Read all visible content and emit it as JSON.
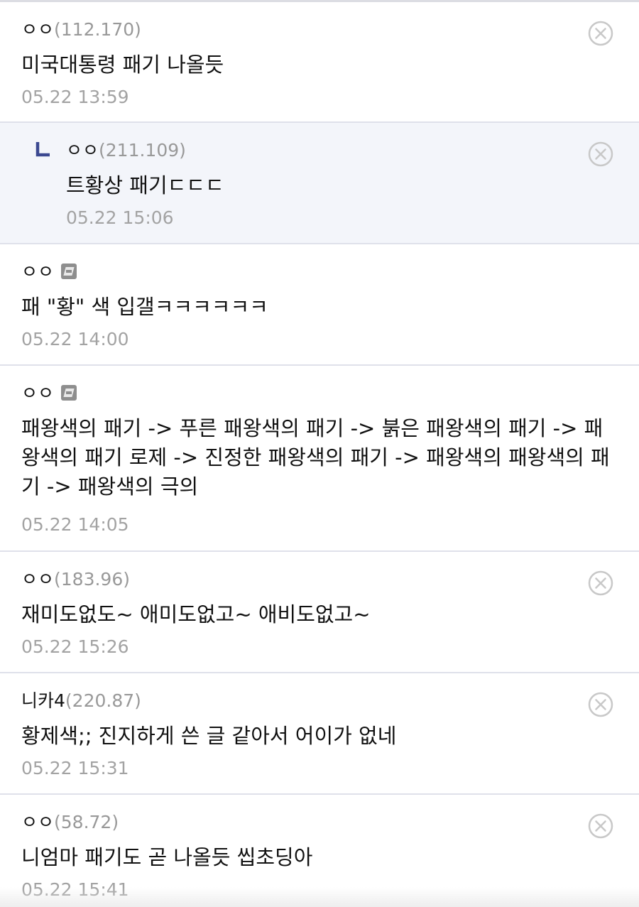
{
  "comments": [
    {
      "name": "ㅇㅇ",
      "ip": "(112.170)",
      "text": "미국대통령 패기 나올듯",
      "date": "05.22 13:59"
    },
    {
      "name": "ㅇㅇ",
      "ip": "(211.109)",
      "text": "트황상 패기ㄷㄷㄷ",
      "date": "05.22 15:06"
    },
    {
      "name": "ㅇㅇ",
      "text": "패 \"황\" 색 입갤ㅋㅋㅋㅋㅋㅋ",
      "date": "05.22 14:00"
    },
    {
      "name": "ㅇㅇ",
      "text": "패왕색의 패기 -> 푸른 패왕색의 패기 -> 붉은 패왕색의 패기 -> 패왕색의 패기 로제 -> 진정한 패왕색의 패기 -> 패왕색의 패왕색의 패기 -> 패왕색의 극의",
      "date": "05.22 14:05"
    },
    {
      "name": "ㅇㅇ",
      "ip": "(183.96)",
      "text": "재미도없도~ 애미도없고~ 애비도없고~",
      "date": "05.22 15:26"
    },
    {
      "name": "니카4",
      "ip": "(220.87)",
      "text": "황제색;; 진지하게 쓴 글 같아서 어이가 없네",
      "date": "05.22 15:31"
    },
    {
      "name": "ㅇㅇ",
      "ip": "(58.72)",
      "text": "니엄마 패기도 곧 나올듯 씹초딩아",
      "date": "05.22 15:41"
    }
  ],
  "icons": {
    "delete": "circle-x-icon",
    "reply": "reply-arrow-icon",
    "gallery_badge": "fixed-nick-badge-icon"
  },
  "colors": {
    "divider": "#dfe1ea",
    "reply_background": "#f3f5fa",
    "reply_mark": "#3b4890",
    "ip_text": "#999999",
    "date_text": "#a3a3a3",
    "delete_icon": "#c8c8c8"
  }
}
